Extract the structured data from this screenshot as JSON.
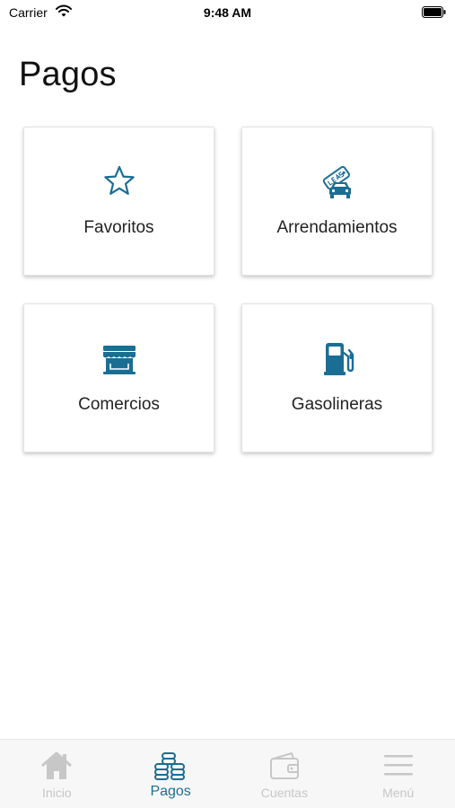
{
  "status_bar": {
    "carrier": "Carrier",
    "time": "9:48 AM"
  },
  "page": {
    "title": "Pagos"
  },
  "cards": {
    "favoritos": {
      "label": "Favoritos",
      "icon": "star-icon"
    },
    "arrendamientos": {
      "label": "Arrendamientos",
      "icon": "lease-car-icon"
    },
    "comercios": {
      "label": "Comercios",
      "icon": "store-icon"
    },
    "gasolineras": {
      "label": "Gasolineras",
      "icon": "fuel-pump-icon"
    }
  },
  "tab_bar": {
    "tabs": [
      {
        "label": "Inicio",
        "icon": "home-icon",
        "active": false
      },
      {
        "label": "Pagos",
        "icon": "coins-icon",
        "active": true
      },
      {
        "label": "Cuentas",
        "icon": "wallet-icon",
        "active": false
      },
      {
        "label": "Menú",
        "icon": "hamburger-icon",
        "active": false
      }
    ]
  },
  "colors": {
    "accent": "#1a6e94",
    "inactive": "#c7c7c7",
    "tab_bar_bg": "#f7f7f7"
  }
}
